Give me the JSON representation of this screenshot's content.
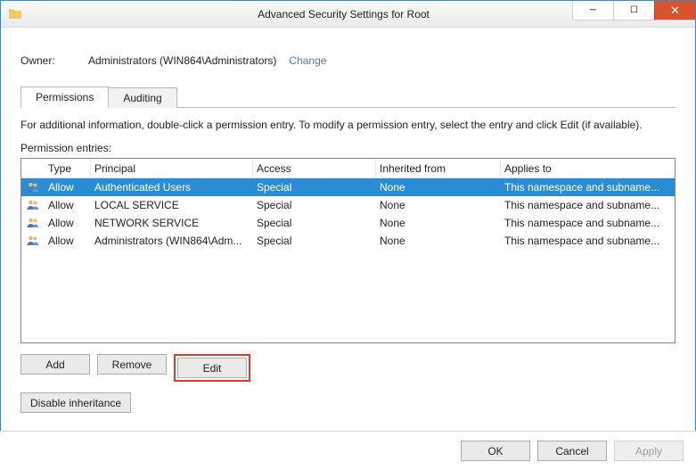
{
  "window": {
    "title": "Advanced Security Settings for Root"
  },
  "owner": {
    "label": "Owner:",
    "value": "Administrators (WIN864\\Administrators)",
    "change": "Change"
  },
  "tabs": {
    "permissions": "Permissions",
    "auditing": "Auditing",
    "active": "permissions"
  },
  "info_text": "For additional information, double-click a permission entry. To modify a permission entry, select the entry and click Edit (if available).",
  "entries_label": "Permission entries:",
  "columns": {
    "type": "Type",
    "principal": "Principal",
    "access": "Access",
    "inherited": "Inherited from",
    "applies": "Applies to"
  },
  "entries": [
    {
      "type": "Allow",
      "principal": "Authenticated Users",
      "access": "Special",
      "inherited": "None",
      "applies": "This namespace and subname...",
      "selected": true
    },
    {
      "type": "Allow",
      "principal": "LOCAL SERVICE",
      "access": "Special",
      "inherited": "None",
      "applies": "This namespace and subname...",
      "selected": false
    },
    {
      "type": "Allow",
      "principal": "NETWORK SERVICE",
      "access": "Special",
      "inherited": "None",
      "applies": "This namespace and subname...",
      "selected": false
    },
    {
      "type": "Allow",
      "principal": "Administrators (WIN864\\Adm...",
      "access": "Special",
      "inherited": "None",
      "applies": "This namespace and subname...",
      "selected": false
    }
  ],
  "buttons": {
    "add": "Add",
    "remove": "Remove",
    "edit": "Edit",
    "disable_inheritance": "Disable inheritance",
    "ok": "OK",
    "cancel": "Cancel",
    "apply": "Apply"
  }
}
